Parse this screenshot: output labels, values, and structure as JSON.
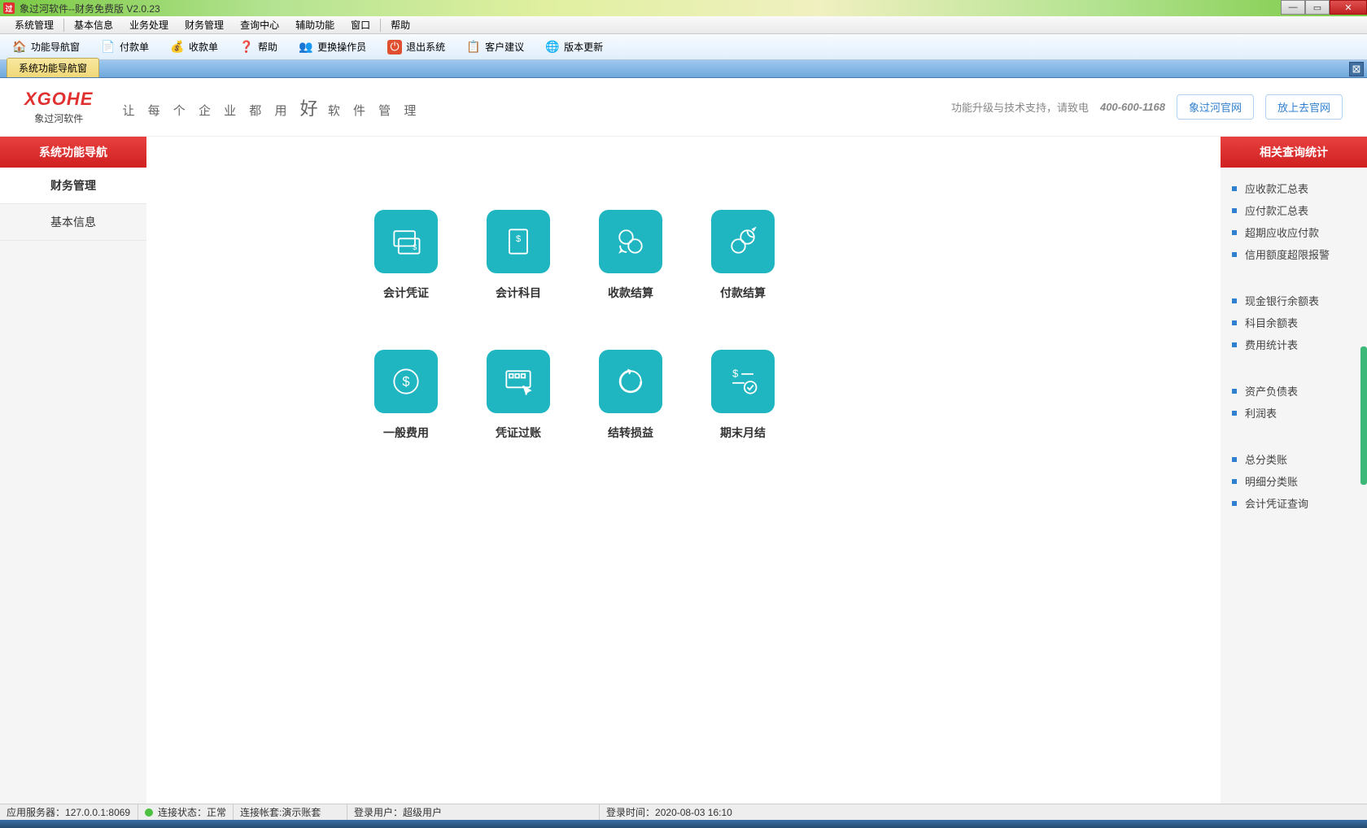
{
  "window": {
    "title": "象过河软件--财务免费版 V2.0.23"
  },
  "menubar": {
    "items": [
      "系统管理",
      "基本信息",
      "业务处理",
      "财务管理",
      "查询中心",
      "辅助功能",
      "窗口",
      "帮助"
    ]
  },
  "toolbar": {
    "items": [
      {
        "icon": "🏠",
        "label": "功能导航窗"
      },
      {
        "icon": "📄",
        "label": "付款单"
      },
      {
        "icon": "💰",
        "label": "收款单"
      },
      {
        "icon": "❓",
        "label": "帮助"
      },
      {
        "icon": "👥",
        "label": "更换操作员"
      },
      {
        "icon": "⏻",
        "label": "退出系统"
      },
      {
        "icon": "📋",
        "label": "客户建议"
      },
      {
        "icon": "🌐",
        "label": "版本更新"
      }
    ]
  },
  "tab": {
    "label": "系统功能导航窗"
  },
  "header": {
    "logo": "XGOHE",
    "logo_sub": "象过河软件",
    "slogan_pre": "让 每 个 企 业 都 用",
    "slogan_big": "好",
    "slogan_post": "软 件 管 理",
    "support_text": "功能升级与技术支持，请致电",
    "phone": "400-600-1168",
    "link1": "象过河官网",
    "link2": "放上去官网"
  },
  "sidebar_left": {
    "header": "系统功能导航",
    "items": [
      {
        "label": "财务管理",
        "active": true
      },
      {
        "label": "基本信息",
        "active": false
      }
    ]
  },
  "tiles": [
    {
      "label": "会计凭证"
    },
    {
      "label": "会计科目"
    },
    {
      "label": "收款结算"
    },
    {
      "label": "付款结算"
    },
    {
      "label": "一般费用"
    },
    {
      "label": "凭证过账"
    },
    {
      "label": "结转损益"
    },
    {
      "label": "期末月结"
    }
  ],
  "sidebar_right": {
    "header": "相关查询统计",
    "groups": [
      [
        "应收款汇总表",
        "应付款汇总表",
        "超期应收应付款",
        "信用额度超限报警"
      ],
      [
        "现金银行余额表",
        "科目余额表",
        "费用统计表"
      ],
      [
        "资产负债表",
        "利润表"
      ],
      [
        "总分类账",
        "明细分类账",
        "会计凭证查询"
      ]
    ]
  },
  "statusbar": {
    "server_label": "应用服务器：",
    "server": "127.0.0.1:8069",
    "conn_label": "连接状态：",
    "conn": "正常",
    "account_label": "连接帐套:",
    "account": "演示账套",
    "user_label": "登录用户：",
    "user": "超级用户",
    "time_label": "登录时间：",
    "time": "2020-08-03 16:10"
  }
}
